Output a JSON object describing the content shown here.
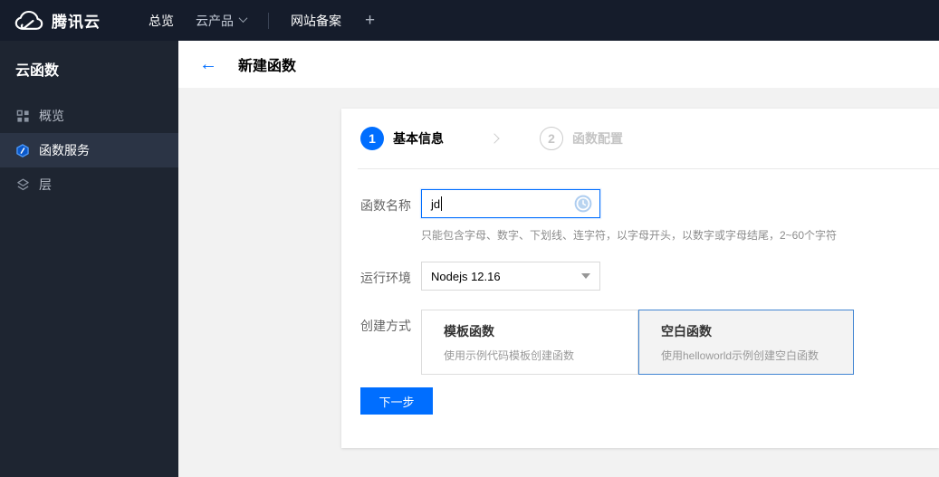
{
  "topnav": {
    "brand": "腾讯云",
    "brand_icon": "tencent-cloud-logo-icon",
    "items": [
      {
        "label": "总览"
      },
      {
        "label": "云产品",
        "icon": "chevron-down-icon"
      },
      {
        "label": "网站备案"
      },
      {
        "label": "+",
        "icon": "plus-icon"
      }
    ]
  },
  "sidebar": {
    "title": "云函数",
    "items": [
      {
        "label": "概览",
        "icon": "grid-overview-icon",
        "selected": false
      },
      {
        "label": "函数服务",
        "icon": "function-hexagon-icon",
        "selected": true
      },
      {
        "label": "层",
        "icon": "layers-icon",
        "selected": false
      }
    ]
  },
  "header": {
    "back_icon": "back-arrow-icon",
    "back_glyph": "←",
    "title": "新建函数"
  },
  "wizard": {
    "steps": [
      {
        "number": "1",
        "label": "基本信息",
        "active": true
      },
      {
        "number": "2",
        "label": "函数配置",
        "active": false
      }
    ],
    "separator_icon": "chevron-right-icon"
  },
  "form": {
    "function_name": {
      "label": "函数名称",
      "value": "jd",
      "status_icon": "pending-clock-icon",
      "help": "只能包含字母、数字、下划线、连字符，以字母开头，以数字或字母结尾，2~60个字符"
    },
    "runtime": {
      "label": "运行环境",
      "value": "Nodejs 12.16",
      "caret_icon": "caret-down-icon"
    },
    "creation_method": {
      "label": "创建方式",
      "options": [
        {
          "title": "模板函数",
          "desc": "使用示例代码模板创建函数",
          "selected": false
        },
        {
          "title": "空白函数",
          "desc": "使用helloworld示例创建空白函数",
          "selected": true
        }
      ]
    },
    "next_button": "下一步"
  },
  "colors": {
    "accent": "#006eff",
    "selected_card_border": "#4285d2",
    "topnav_bg": "#151c2b",
    "sidebar_bg": "#1e2531",
    "sidebar_selected_bg": "#2b3445",
    "page_bg": "#f2f2f2",
    "step_inactive": "#c5c5c5"
  }
}
